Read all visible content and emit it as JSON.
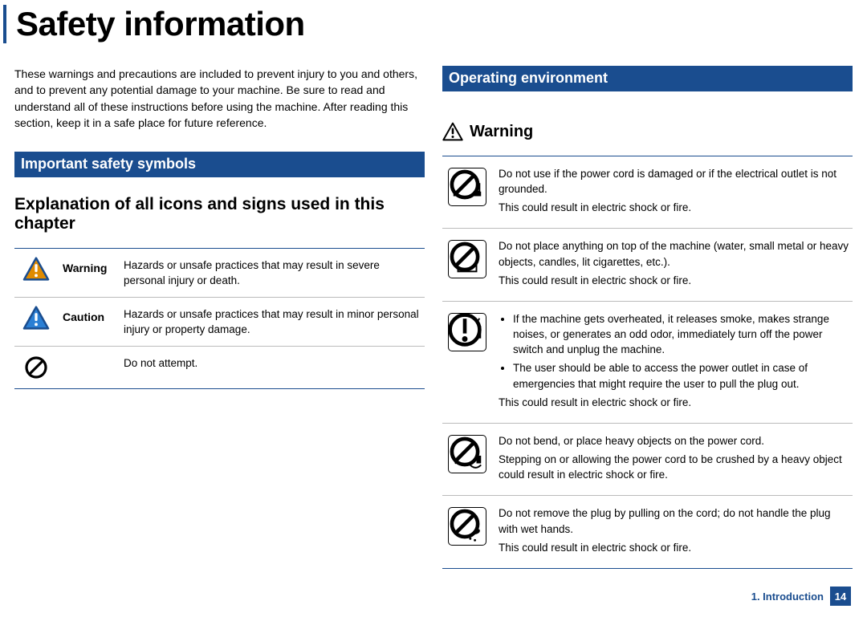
{
  "title": "Safety information",
  "intro": "These warnings and precautions are included to prevent injury to you and others, and to prevent any potential damage to your machine. Be sure to read and understand all of these instructions before using the machine. After reading this section, keep it in a safe place for future reference.",
  "left": {
    "section_title": "Important safety symbols",
    "sub_heading": "Explanation of all icons and signs used in this chapter",
    "rows": [
      {
        "label": "Warning",
        "desc": "Hazards or unsafe practices that may result in severe personal injury or death."
      },
      {
        "label": "Caution",
        "desc": "Hazards or unsafe practices that may result in minor personal injury or property damage."
      },
      {
        "label": "",
        "desc": "Do not attempt."
      }
    ]
  },
  "right": {
    "section_title": "Operating environment",
    "warn_heading": "Warning",
    "items": [
      {
        "paras": [
          "Do not use if the power cord is damaged or if the electrical outlet is not grounded.",
          "This could result in electric shock or fire."
        ]
      },
      {
        "paras": [
          "Do not place anything on top of the machine (water, small metal or heavy objects, candles, lit cigarettes, etc.).",
          "This could result in electric shock or fire."
        ]
      },
      {
        "bullets": [
          "If the machine gets overheated, it releases smoke, makes strange noises, or generates an odd odor, immediately turn off the power switch and unplug the machine.",
          "The user should be able to access the power outlet in case of emergencies that might require the user to pull the plug out."
        ],
        "after": "This could result in electric shock or fire."
      },
      {
        "paras": [
          "Do not bend, or place heavy objects on the power cord.",
          "Stepping on or allowing the power cord to be crushed by a heavy object could result in electric shock or fire."
        ]
      },
      {
        "paras": [
          "Do not remove the plug by pulling on the cord; do not handle the plug with wet hands.",
          "This could result in electric shock or fire."
        ]
      }
    ]
  },
  "footer": {
    "breadcrumb": "1. Introduction",
    "page": "14"
  }
}
